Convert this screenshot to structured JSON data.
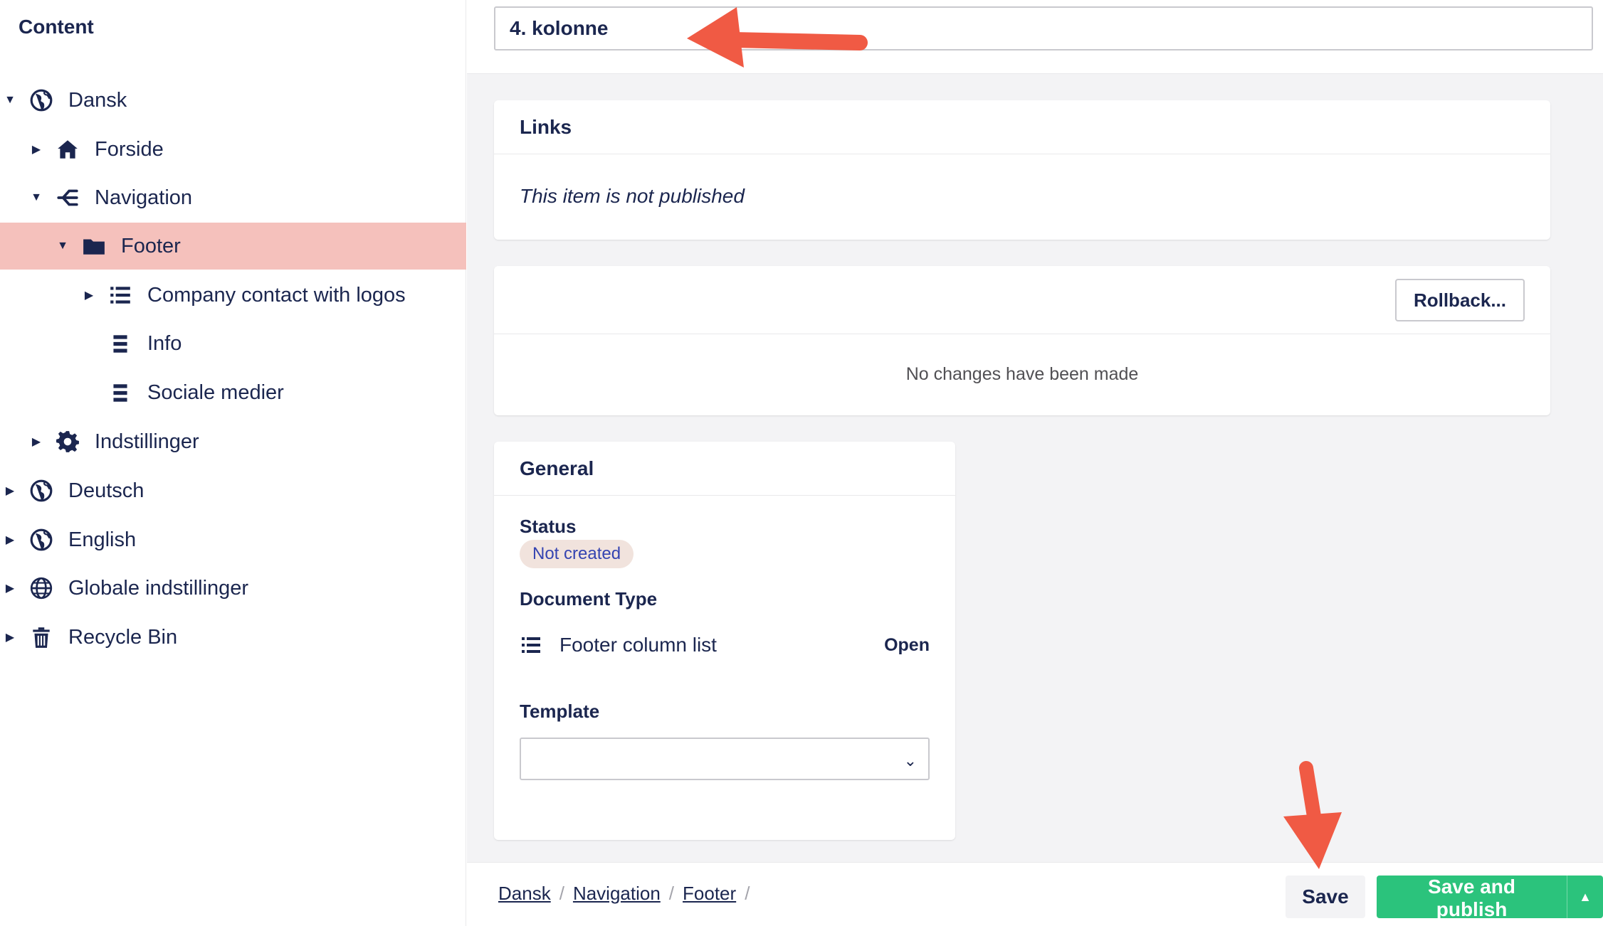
{
  "sidebar": {
    "title": "Content",
    "items": [
      {
        "label": "Dansk",
        "icon": "globe-icon",
        "caret": "down"
      },
      {
        "label": "Forside",
        "icon": "home-icon",
        "caret": "right"
      },
      {
        "label": "Navigation",
        "icon": "sitemap-icon",
        "caret": "down"
      },
      {
        "label": "Footer",
        "icon": "folder-icon",
        "caret": "down",
        "active": true
      },
      {
        "label": "Company contact with logos",
        "icon": "list-icon",
        "caret": "right"
      },
      {
        "label": "Info",
        "icon": "lines-icon",
        "caret": ""
      },
      {
        "label": "Sociale medier",
        "icon": "lines-icon",
        "caret": ""
      },
      {
        "label": "Indstillinger",
        "icon": "gear-icon",
        "caret": "right"
      },
      {
        "label": "Deutsch",
        "icon": "globe-icon",
        "caret": "right"
      },
      {
        "label": "English",
        "icon": "globe-icon",
        "caret": "right"
      },
      {
        "label": "Globale indstillinger",
        "icon": "world-grid-icon",
        "caret": "right"
      },
      {
        "label": "Recycle Bin",
        "icon": "trash-icon",
        "caret": "right"
      }
    ]
  },
  "header": {
    "name_value": "4. kolonne"
  },
  "links_card": {
    "title": "Links",
    "note": "This item is not published"
  },
  "history_card": {
    "rollback_label": "Rollback...",
    "message": "No changes have been made"
  },
  "general_card": {
    "title": "General",
    "status_label": "Status",
    "status_value": "Not created",
    "doctype_label": "Document Type",
    "doctype_value": "Footer column list",
    "doctype_open": "Open",
    "template_label": "Template",
    "template_value": ""
  },
  "footer": {
    "breadcrumb": [
      "Dansk",
      "Navigation",
      "Footer"
    ],
    "separator": "/",
    "save_label": "Save",
    "publish_label": "Save and publish",
    "publish_more_glyph": "▲"
  },
  "colors": {
    "accent_text": "#1b264f",
    "active_row": "#f5c1bc",
    "publish_green": "#2bc37c",
    "annotation_arrow": "#f05a44"
  }
}
